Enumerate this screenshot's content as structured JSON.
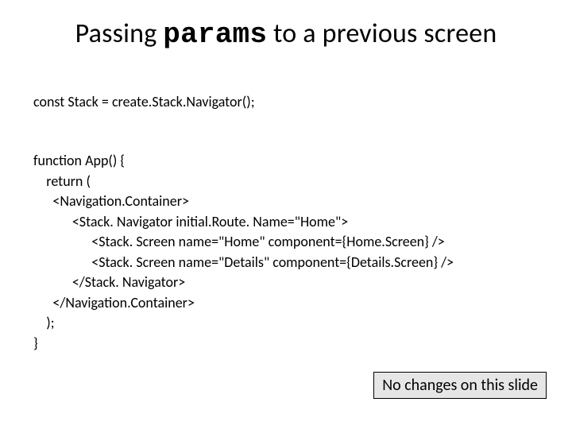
{
  "title": {
    "pre": "Passing ",
    "mono": "params",
    "post": " to a previous screen"
  },
  "line_const": "const Stack = create.Stack.Navigator();",
  "code": "function App() {\n    return (\n      <Navigation.Container>\n            <Stack. Navigator initial.Route. Name=\"Home\">\n                  <Stack. Screen name=\"Home\" component={Home.Screen} />\n                  <Stack. Screen name=\"Details\" component={Details.Screen} />\n            </Stack. Navigator>\n      </Navigation.Container>\n    );\n}",
  "note": "No changes on this slide"
}
